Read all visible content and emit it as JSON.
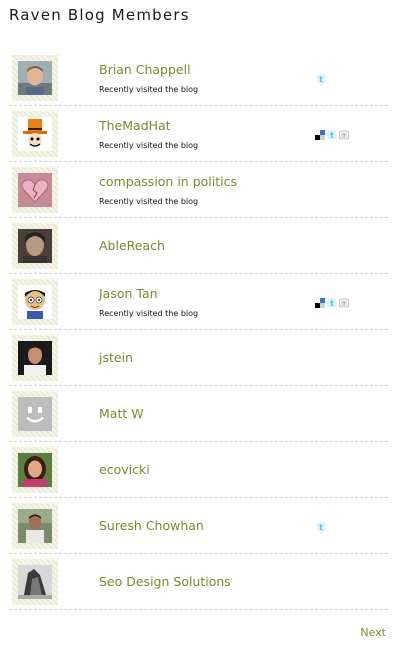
{
  "page": {
    "title": "Raven Blog Members",
    "next_label": "Next"
  },
  "colors": {
    "name_link": "#7a8a28",
    "divider": "#d2d2d2",
    "twitter_blue": "#33ccff"
  },
  "members": [
    {
      "name": "Brian Chappell",
      "status": "Recently visited the blog",
      "icons": [
        "twitter-icon"
      ]
    },
    {
      "name": "TheMadHat",
      "status": "Recently visited the blog",
      "icons": [
        "delicious-icon",
        "twitter-icon",
        "friendfeed-icon"
      ]
    },
    {
      "name": "compassion in politics",
      "status": "Recently visited the blog",
      "icons": []
    },
    {
      "name": "AbleReach",
      "status": "",
      "icons": []
    },
    {
      "name": "Jason Tan",
      "status": "Recently visited the blog",
      "icons": [
        "delicious-icon",
        "twitter-icon",
        "friendfeed-icon"
      ]
    },
    {
      "name": "jstein",
      "status": "",
      "icons": []
    },
    {
      "name": "Matt W",
      "status": "",
      "icons": []
    },
    {
      "name": "ecovicki",
      "status": "",
      "icons": []
    },
    {
      "name": "Suresh Chowhan",
      "status": "",
      "icons": [
        "twitter-icon"
      ]
    },
    {
      "name": "Seo Design Solutions",
      "status": "",
      "icons": []
    }
  ]
}
